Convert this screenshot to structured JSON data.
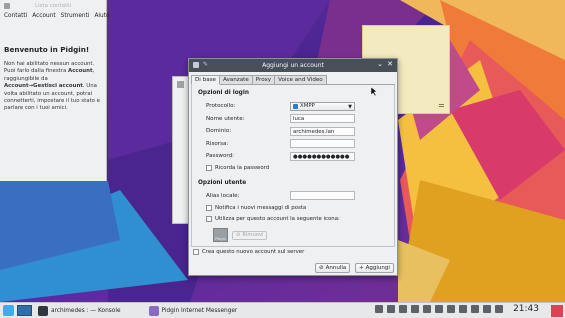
{
  "colors": {
    "dialog_title_bg": "#475057",
    "accent": "#3daee9",
    "note": "#f4eac0"
  },
  "buddy_list": {
    "title": "Lista contatti",
    "menu": [
      "Contatti",
      "Account",
      "Strumenti",
      "Aiuto"
    ],
    "welcome": "Benvenuto in Pidgin!",
    "info_1": "Non hai abilitato nessun account. Puoi farlo dalla finestra ",
    "info_bold_1": "Account",
    "info_2": ", raggiungibile da ",
    "info_bold_2": "Account→Gestisci account",
    "info_3": ". Una volta abilitato un account, potrai connetterti, impostare il tuo stato e parlare con i tuoi amici."
  },
  "dialog": {
    "title": "Aggiungi un account",
    "tabs": [
      "Di base",
      "Avanzate",
      "Proxy",
      "Voice and Video"
    ],
    "login_section": "Opzioni di login",
    "protocol_label": "Protocollo:",
    "protocol_value": "XMPP",
    "username_label": "Nome utente:",
    "username_value": "luca",
    "domain_label": "Dominio:",
    "domain_value": "archimedes.lan",
    "resource_label": "Risorsa:",
    "resource_value": "",
    "password_label": "Password:",
    "password_value": "●●●●●●●●●●●●",
    "remember_password": "Ricorda la password",
    "user_section": "Opzioni utente",
    "alias_label": "Alias locale:",
    "alias_value": "",
    "notify_mail": "Notifica i nuovi messaggi di posta",
    "use_icon": "Utilizza per questo account la seguente icona:",
    "icon_label": "Pidgin",
    "remove_button": "Rimuovi",
    "create_on_server": "Crea questo nuovo account sul server",
    "cancel_button": "Annulla",
    "add_button": "Aggiungi"
  },
  "taskbar": {
    "task_1": "archimedes : — Konsole",
    "task_2": "Pidgin Internet Messenger",
    "clock": "21:43"
  }
}
